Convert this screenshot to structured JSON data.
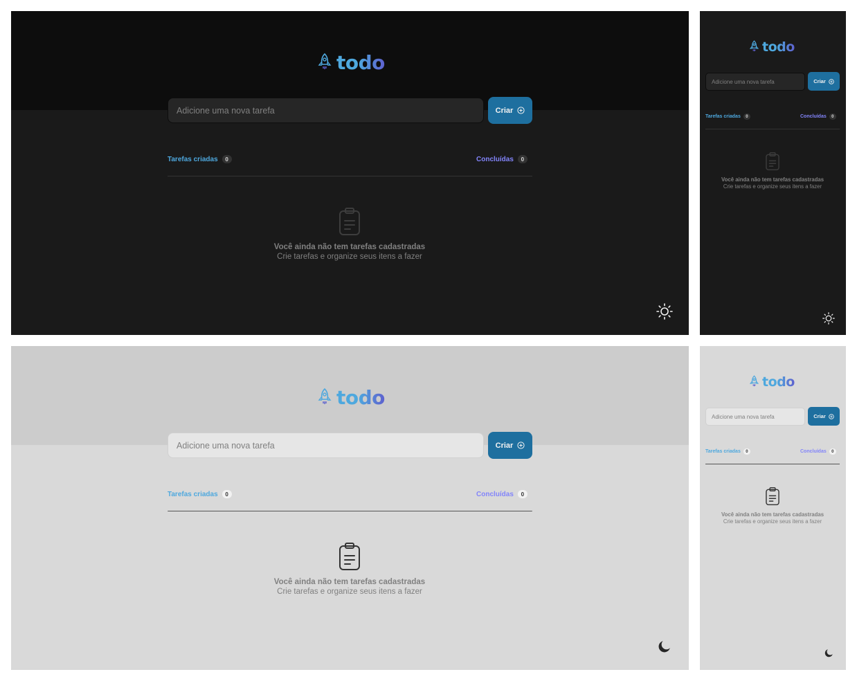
{
  "app": {
    "logo_text": "todo"
  },
  "form": {
    "placeholder": "Adicione uma nova tarefa",
    "create_label": "Criar"
  },
  "counters": {
    "created_label": "Tarefas criadas",
    "created_count": "0",
    "done_label": "Concluídas",
    "done_count": "0"
  },
  "empty": {
    "title": "Você ainda não tem tarefas cadastradas",
    "subtitle": "Crie tarefas e organize seus itens a fazer"
  },
  "colors": {
    "accent_blue": "#4ea8de",
    "accent_purple": "#8284fa",
    "button_blue": "#1e6f9f",
    "dark_header": "#0d0d0d",
    "dark_body": "#1a1a1a",
    "light_header": "#cccccc",
    "light_body": "#d9d9d9"
  },
  "icons": {
    "logo": "rocket-icon",
    "create": "plus-circle-icon",
    "empty": "clipboard-icon",
    "dark_theme_toggle": "sun-icon",
    "light_theme_toggle": "moon-icon"
  }
}
